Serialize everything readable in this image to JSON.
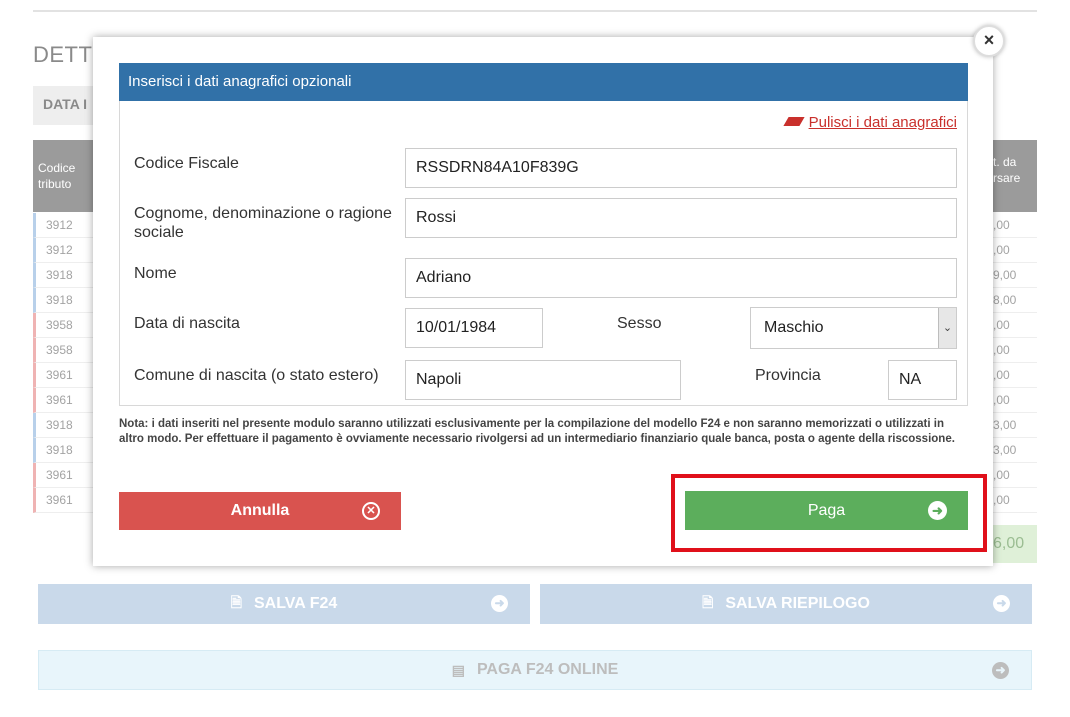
{
  "background": {
    "title": "DETT",
    "tab": "DATA I",
    "table_head_left": [
      "Codice",
      "tributo"
    ],
    "table_head_right": [
      "t. da",
      "rsare"
    ],
    "rows_left": [
      "3912",
      "3912",
      "3918",
      "3918",
      "3958",
      "3958",
      "3961",
      "3961",
      "3918",
      "3918",
      "3961",
      "3961"
    ],
    "rows_right": [
      ",00",
      ",00",
      "9,00",
      "8,00",
      ",00",
      ",00",
      ",00",
      ",00",
      "3,00",
      "3,00",
      ",00",
      ",00"
    ],
    "total": "6,00",
    "save_f24": "SALVA F24",
    "save_summary": "SALVA RIEPILOGO",
    "pay_online": "PAGA F24 ONLINE"
  },
  "modal": {
    "close_glyph": "×",
    "header": "Inserisci i dati anagrafici opzionali",
    "clear_link": "Pulisci i dati anagrafici",
    "fields": {
      "codice_fiscale": {
        "label": "Codice Fiscale",
        "value": "RSSDRN84A10F839G"
      },
      "cognome": {
        "label": "Cognome, denominazione o ragione sociale",
        "value": "Rossi"
      },
      "nome": {
        "label": "Nome",
        "value": "Adriano"
      },
      "data_nascita": {
        "label": "Data di nascita",
        "value": "10/01/1984"
      },
      "sesso": {
        "label": "Sesso",
        "value": "Maschio"
      },
      "comune": {
        "label": "Comune di nascita (o stato estero)",
        "value": "Napoli"
      },
      "provincia": {
        "label": "Provincia",
        "value": "NA"
      }
    },
    "note": "Nota: i dati inseriti nel presente modulo saranno utilizzati esclusivamente per la compilazione del modello F24 e non saranno memorizzati o utilizzati in altro modo. Per effettuare il pagamento è ovviamente necessario rivolgersi ad un intermediario finanziario quale banca, posta o agente della riscossione.",
    "cancel_label": "Annulla",
    "pay_label": "Paga"
  },
  "colors": {
    "header": "#3171a8",
    "cancel": "#d9534f",
    "pay": "#5cae5c",
    "highlight": "#e0101a"
  }
}
